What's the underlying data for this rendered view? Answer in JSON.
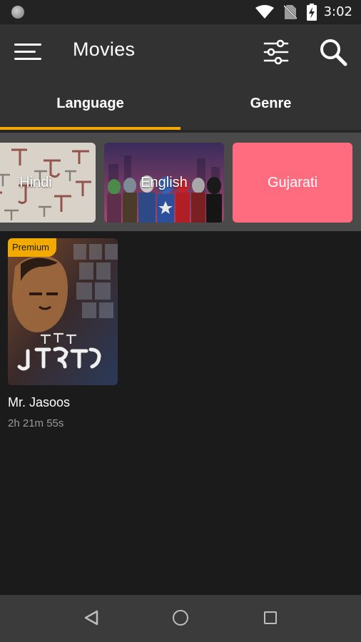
{
  "status_bar": {
    "time": "3:02"
  },
  "app_bar": {
    "title": "Movies"
  },
  "tabs": [
    {
      "label": "Language",
      "selected": true
    },
    {
      "label": "Genre",
      "selected": false
    }
  ],
  "accent_color": "#f2a900",
  "languages": [
    {
      "label": "Hindi"
    },
    {
      "label": "English"
    },
    {
      "label": "Gujarati",
      "color": "#ff6c80"
    }
  ],
  "movies": [
    {
      "badge": "Premium",
      "title": "Mr. Jasoos",
      "duration": "2h 21m 55s"
    }
  ],
  "icons": {
    "menu": "hamburger-icon",
    "filter": "sliders-icon",
    "search": "search-icon",
    "nav_back": "triangle-back-icon",
    "nav_home": "circle-home-icon",
    "nav_recent": "square-recent-icon"
  }
}
